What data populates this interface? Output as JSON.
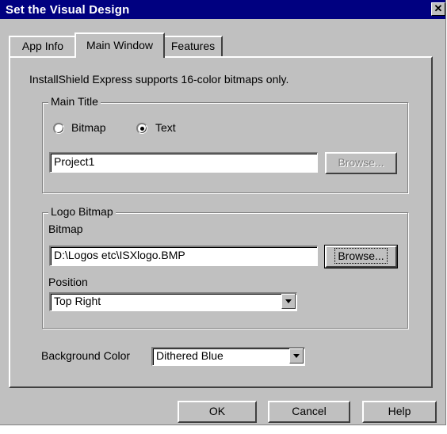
{
  "window": {
    "title": "Set the Visual Design",
    "close_glyph": "✕"
  },
  "tabs": [
    {
      "label": "App Info",
      "active": false
    },
    {
      "label": "Main Window",
      "active": true
    },
    {
      "label": "Features",
      "active": false
    }
  ],
  "panel": {
    "note": "InstallShield Express supports 16-color bitmaps only."
  },
  "main_title": {
    "group_label": "Main Title",
    "radio_bitmap": "Bitmap",
    "radio_text": "Text",
    "selected": "Text",
    "value": "Project1",
    "browse_label": "Browse..."
  },
  "logo_bitmap": {
    "group_label": "Logo Bitmap",
    "bitmap_label": "Bitmap",
    "bitmap_value": "D:\\Logos etc\\ISXlogo.BMP",
    "browse_label": "Browse...",
    "position_label": "Position",
    "position_value": "Top Right"
  },
  "background": {
    "label": "Background Color",
    "value": "Dithered Blue"
  },
  "buttons": {
    "ok": "OK",
    "cancel": "Cancel",
    "help": "Help"
  },
  "icons": {
    "close": "close-icon",
    "dropdown": "chevron-down-icon"
  },
  "colors": {
    "face": "#c0c0c0",
    "titlebar": "#000080"
  }
}
